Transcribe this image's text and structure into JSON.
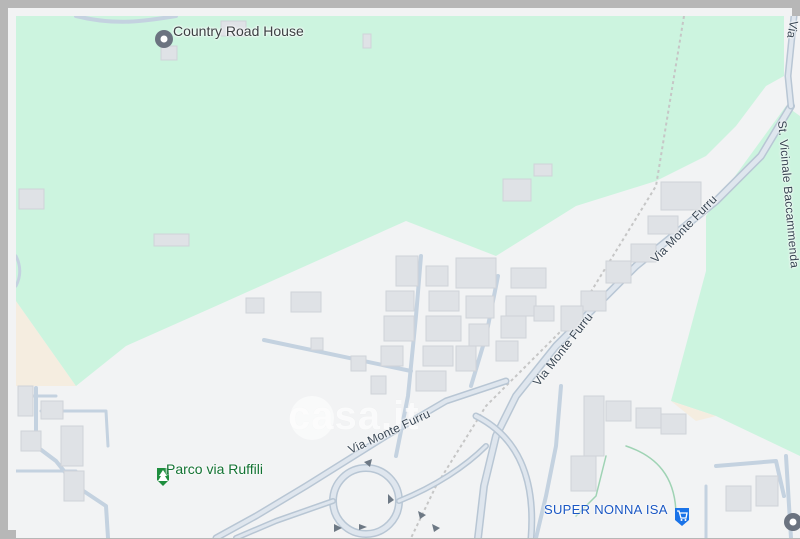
{
  "map": {
    "colors": {
      "land": "#f2f3f4",
      "park": "#ccf4df",
      "sand": "#f5ede0",
      "road": "#c4d2e0",
      "building": "#dfe2e6",
      "rail": "#c9c9c9",
      "poi_gray": "#6b7380",
      "poi_green": "#1e8e3e",
      "poi_blue": "#1a73e8"
    },
    "pois": [
      {
        "name": "Country Road House",
        "icon": "place-pin-icon",
        "category": "place"
      },
      {
        "name": "Parco via Ruffili",
        "icon": "tree-icon",
        "category": "park"
      },
      {
        "name": "SUPER NONNA ISA",
        "icon": "shopping-cart-icon",
        "category": "shop"
      }
    ],
    "streets": [
      {
        "name": "Via Monte Furru"
      },
      {
        "name": "Via Monte Furru"
      },
      {
        "name": "Via Monte Furru"
      },
      {
        "name": "St. Vicinale Baccammenda"
      },
      {
        "name": "Via"
      }
    ],
    "watermark": "casa.it"
  }
}
